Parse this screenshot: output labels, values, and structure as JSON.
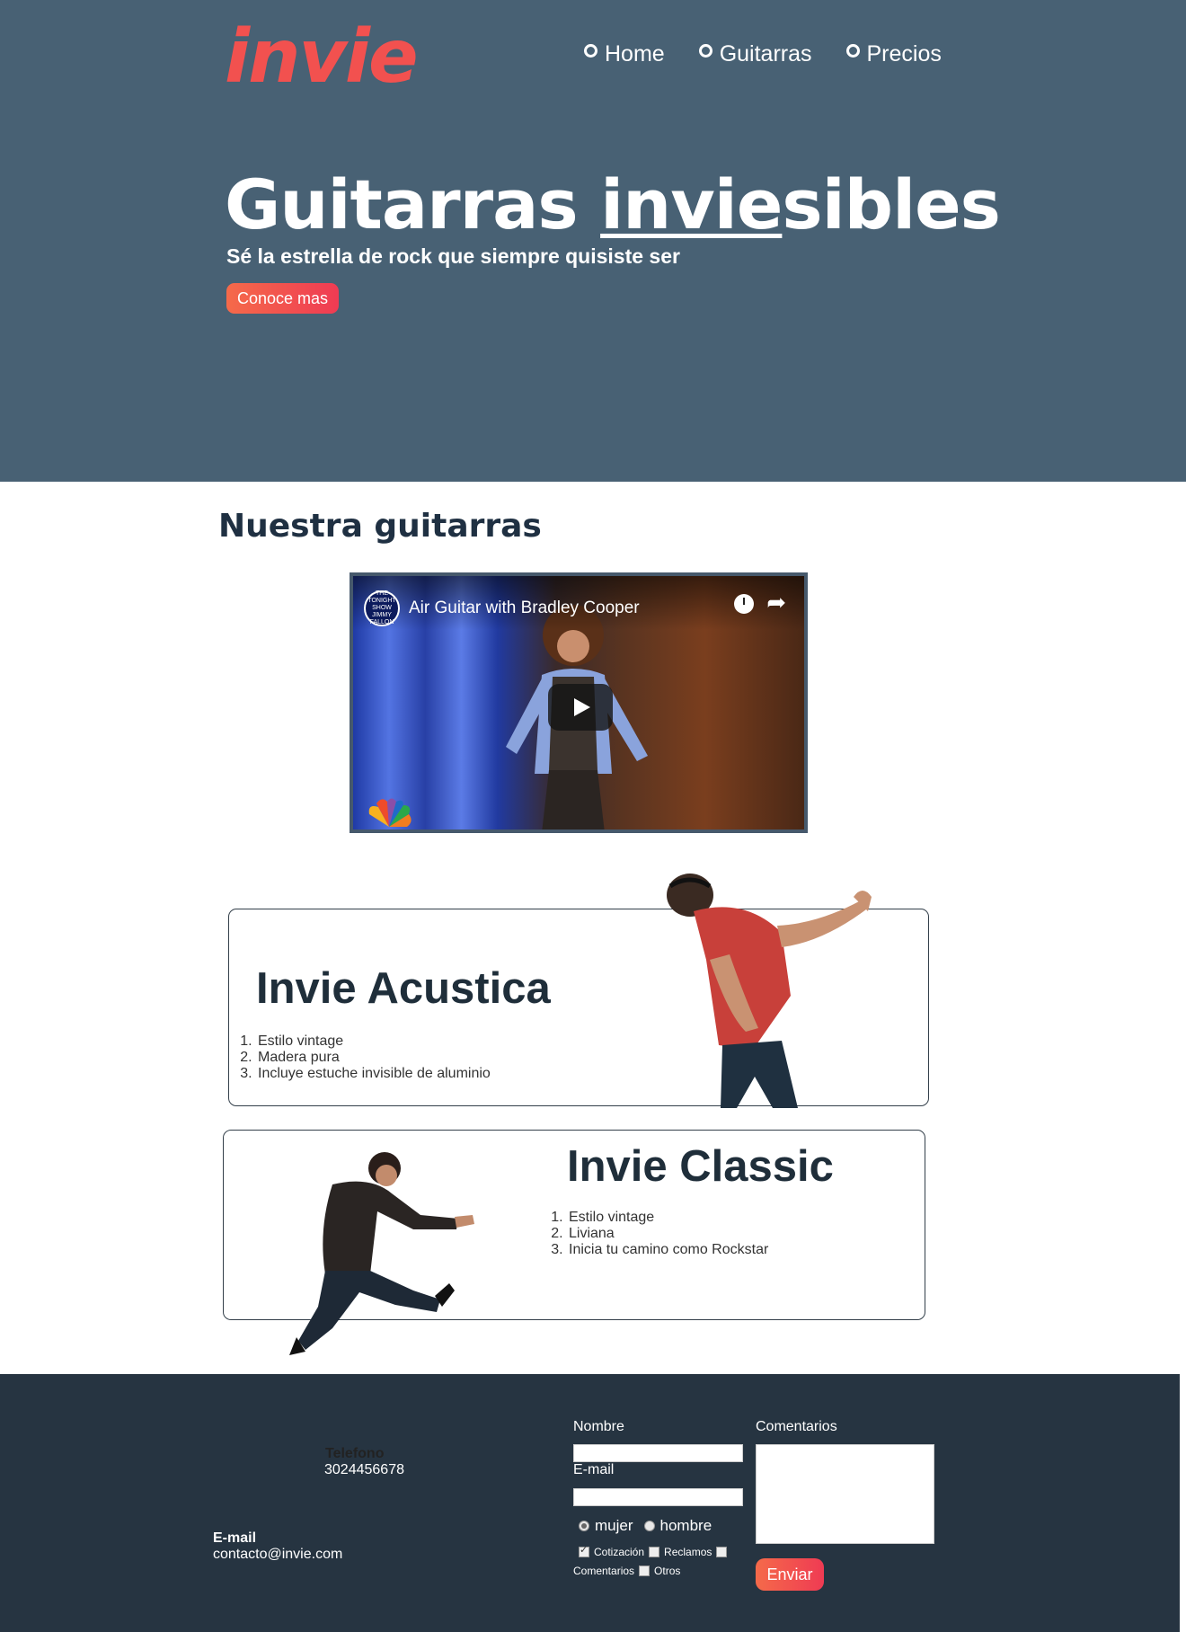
{
  "brand": {
    "logo_text": "invie",
    "logo_color": "#f2514f"
  },
  "nav": {
    "items": [
      "Home",
      "Guitarras",
      "Precios"
    ]
  },
  "hero": {
    "title_pre": "Guitarras ",
    "title_underlined": "invie",
    "title_post": "sibles",
    "subtitle": "Sé la estrella de rock que siempre quisiste ser",
    "cta_label": "Conoce mas",
    "background": "#486174"
  },
  "products": {
    "section_title": "Nuestra guitarras",
    "video": {
      "title": "Air Guitar with Bradley Cooper",
      "channel_badge": "THE TONIGHT SHOW JIMMY FALLON",
      "play_icon": "play-icon",
      "share_icon": "share-icon",
      "watch_later_icon": "clock-icon"
    },
    "cards": [
      {
        "title": "Invie Acustica",
        "features": [
          "Estilo vintage",
          "Madera pura",
          "Incluye estuche invisible de aluminio"
        ]
      },
      {
        "title": "Invie Classic",
        "features": [
          "Estilo vintage",
          "Liviana",
          "Inicia tu camino como Rockstar"
        ]
      }
    ]
  },
  "footer": {
    "background": "#263441",
    "phone_label": "Telefono",
    "phone_value": "3024456678",
    "email_label": "E-mail",
    "email_value": "contacto@invie.com",
    "form": {
      "name_label": "Nombre",
      "email_label": "E-mail",
      "comments_label": "Comentarios",
      "gender_options": [
        "mujer",
        "hombre"
      ],
      "gender_selected": "mujer",
      "topics": [
        "Cotización",
        "Reclamos",
        "Comentarios",
        "Otros"
      ],
      "topics_checked": [
        "Cotización"
      ],
      "submit_label": "Enviar"
    }
  }
}
